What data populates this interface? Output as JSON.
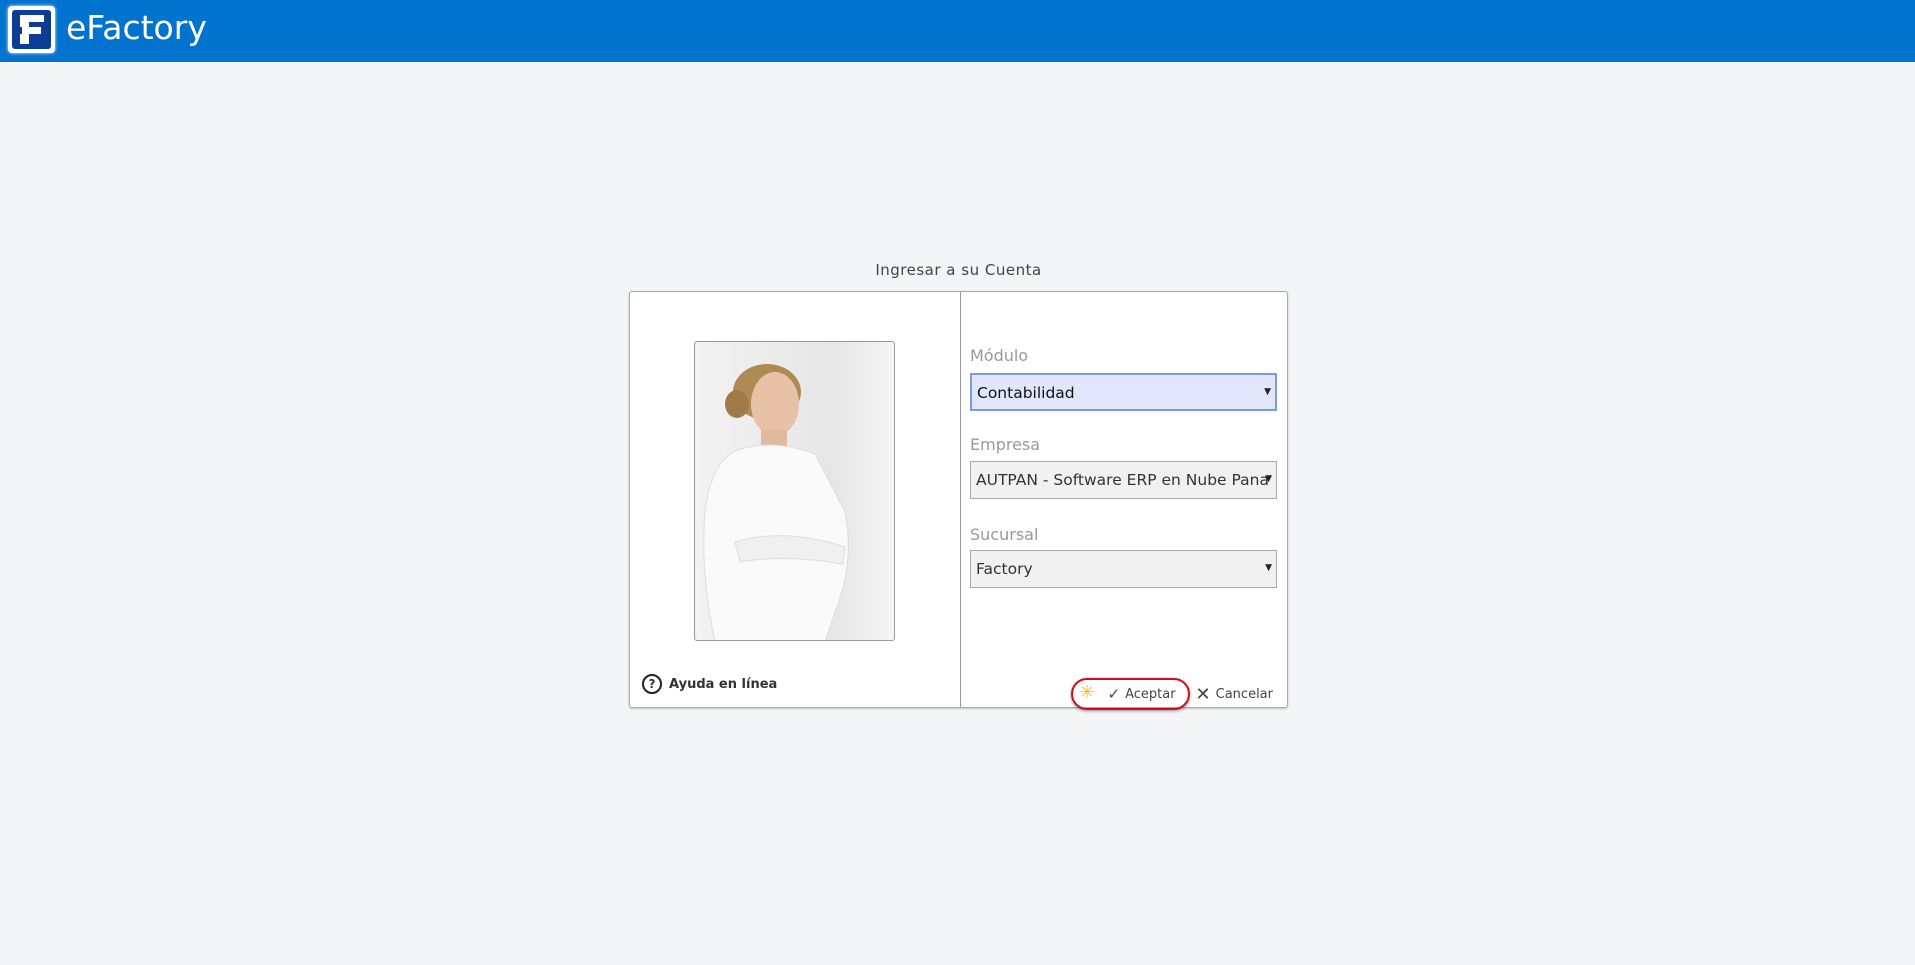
{
  "header": {
    "app_title": "eFactory",
    "brand_color": "#0073cf"
  },
  "dialog": {
    "title": "Ingresar a su Cuenta",
    "help_label": "Ayuda en línea",
    "modulo": {
      "label": "Módulo",
      "value": "Contabilidad"
    },
    "empresa": {
      "label": "Empresa",
      "value": "AUTPAN - Software ERP en Nube Pana"
    },
    "sucursal": {
      "label": "Sucursal",
      "value": "Factory"
    },
    "accept_label": "Aceptar",
    "cancel_label": "Cancelar"
  }
}
